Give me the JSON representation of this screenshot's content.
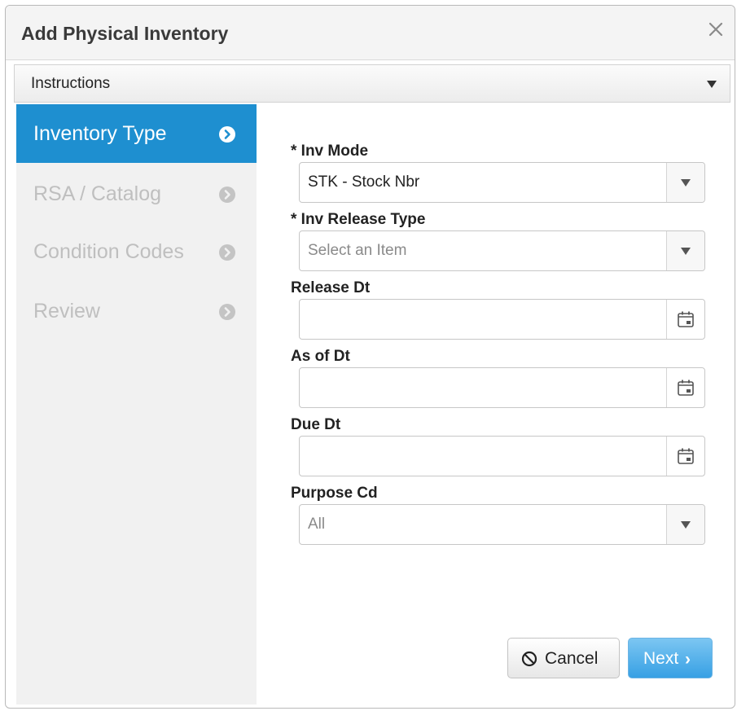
{
  "dialog": {
    "title": "Add Physical Inventory"
  },
  "instructions": {
    "label": "Instructions"
  },
  "steps": [
    {
      "label": "Inventory Type",
      "active": true
    },
    {
      "label": "RSA / Catalog",
      "active": false
    },
    {
      "label": "Condition Codes",
      "active": false
    },
    {
      "label": "Review",
      "active": false
    }
  ],
  "form": {
    "inv_mode": {
      "label": "* Inv Mode",
      "value": "STK - Stock Nbr"
    },
    "inv_release_type": {
      "label": "* Inv Release Type",
      "placeholder": "Select an Item"
    },
    "release_dt": {
      "label": "Release Dt",
      "value": ""
    },
    "as_of_dt": {
      "label": "As of Dt",
      "value": ""
    },
    "due_dt": {
      "label": "Due Dt",
      "value": ""
    },
    "purpose_cd": {
      "label": "Purpose Cd",
      "value": "All"
    }
  },
  "buttons": {
    "cancel": "Cancel",
    "next": "Next",
    "next_chevron": "›"
  },
  "colors": {
    "accent": "#1e8fd0",
    "next_button": "#37a0e4"
  },
  "icons": [
    "close-icon",
    "chevron-down-icon",
    "chevron-circle-right-icon",
    "calendar-icon",
    "ban-icon"
  ]
}
